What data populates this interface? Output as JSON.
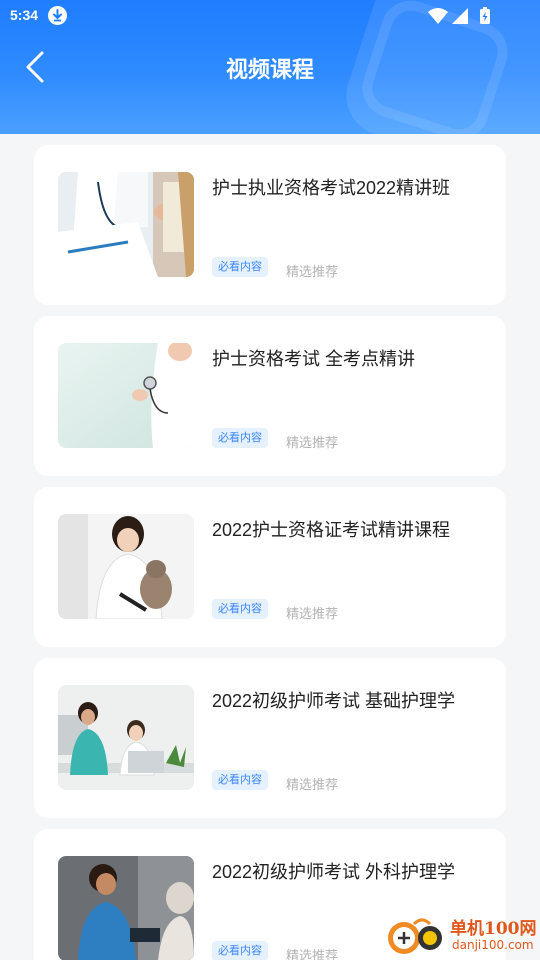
{
  "status_bar": {
    "time": "5:34",
    "icons": [
      "download-icon",
      "wifi-icon",
      "signal-icon",
      "battery-icon"
    ]
  },
  "header": {
    "title": "视频课程",
    "back_icon": "chevron-left-icon"
  },
  "courses": [
    {
      "title": "护士执业资格考试2022精讲班",
      "tag": "必看内容",
      "recommend": "精选推荐",
      "thumb": "doctor-stethoscope-photo"
    },
    {
      "title": "护士资格考试 全考点精讲",
      "tag": "必看内容",
      "recommend": "精选推荐",
      "thumb": "doctor-stethoscope-photo"
    },
    {
      "title": "2022护士资格证考试精讲课程",
      "tag": "必看内容",
      "recommend": "精选推荐",
      "thumb": "vet-with-cat-photo"
    },
    {
      "title": "2022初级护师考试 基础护理学",
      "tag": "必看内容",
      "recommend": "精选推荐",
      "thumb": "nurses-desk-photo"
    },
    {
      "title": "2022初级护师考试 外科护理学",
      "tag": "必看内容",
      "recommend": "精选推荐",
      "thumb": "nurse-patient-photo"
    }
  ],
  "watermark": {
    "line1": "单机100网",
    "line2": "danji100.com"
  },
  "colors": {
    "header_blue": "#1f7dff",
    "tag_bg": "#e6f1ff",
    "tag_text": "#3a86ff",
    "watermark": "#e0571b"
  }
}
